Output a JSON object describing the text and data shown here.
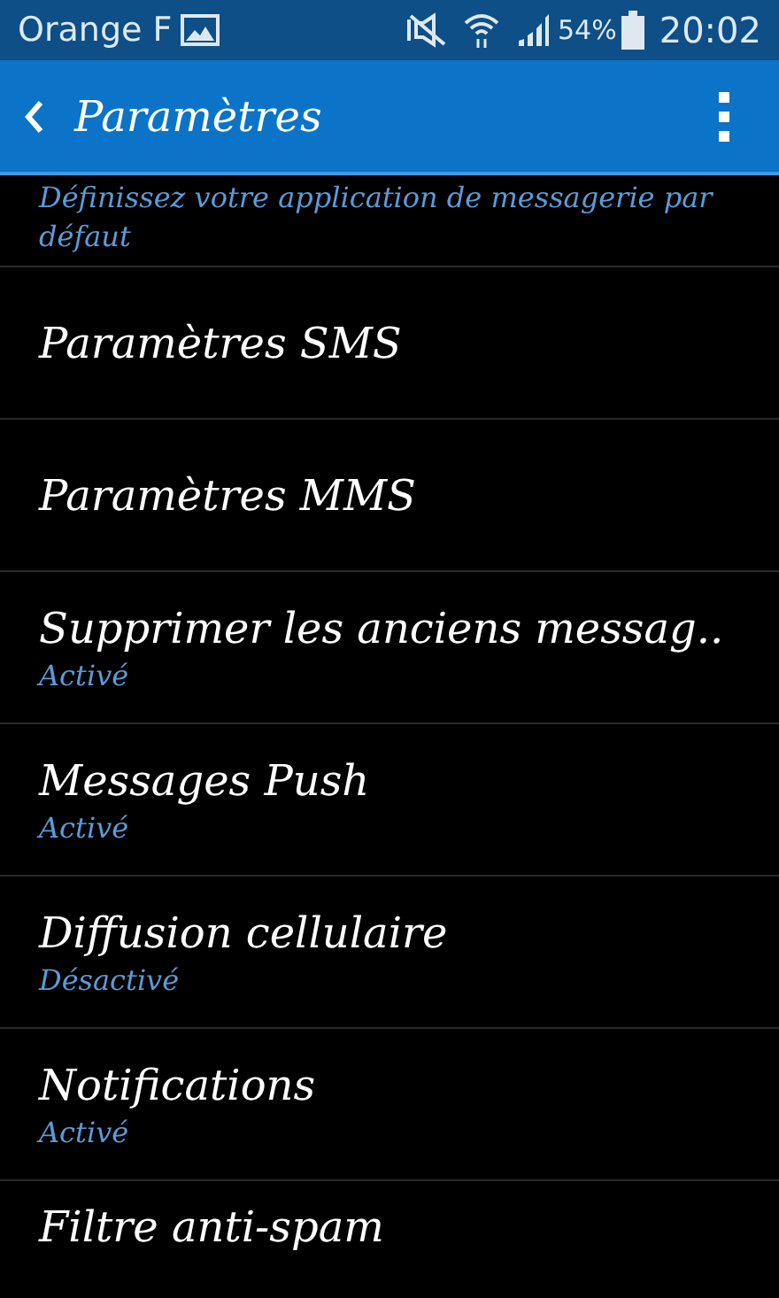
{
  "status_bar": {
    "carrier": "Orange F",
    "battery": "54%",
    "time": "20:02"
  },
  "app_bar": {
    "title": "Paramètres"
  },
  "intro": {
    "subtitle": "Définissez votre application de messagerie par défaut"
  },
  "items": [
    {
      "title": "Paramètres SMS"
    },
    {
      "title": "Paramètres MMS"
    },
    {
      "title": "Supprimer les anciens messag..",
      "subtitle": "Activé"
    },
    {
      "title": "Messages Push",
      "subtitle": "Activé"
    },
    {
      "title": "Diffusion cellulaire",
      "subtitle": "Désactivé"
    },
    {
      "title": "Notifications",
      "subtitle": "Activé"
    },
    {
      "title": "Filtre anti-spam"
    }
  ]
}
